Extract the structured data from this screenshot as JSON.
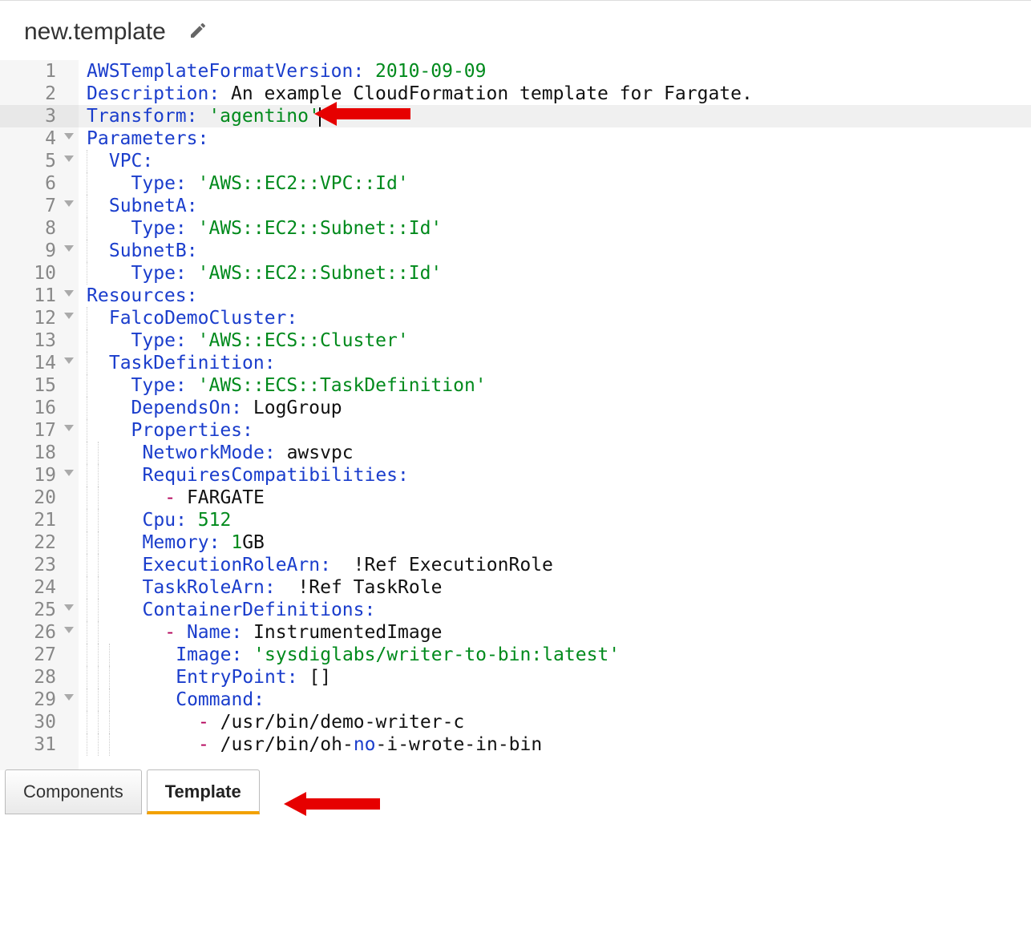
{
  "header": {
    "title": "new.template"
  },
  "tabs": {
    "components": "Components",
    "template": "Template"
  },
  "code": {
    "lines": [
      {
        "num": "1",
        "fold": false,
        "active": false,
        "tokens": [
          {
            "c": "key",
            "t": "AWSTemplateFormatVersion: "
          },
          {
            "c": "str",
            "t": "2010-09-09"
          }
        ]
      },
      {
        "num": "2",
        "fold": false,
        "active": false,
        "tokens": [
          {
            "c": "key",
            "t": "Description: "
          },
          {
            "c": "txt",
            "t": "An example CloudFormation template for Fargate."
          }
        ]
      },
      {
        "num": "3",
        "fold": false,
        "active": true,
        "tokens": [
          {
            "c": "key",
            "t": "Transform: "
          },
          {
            "c": "str",
            "t": "'agentino'"
          }
        ],
        "cursor": true
      },
      {
        "num": "4",
        "fold": true,
        "active": false,
        "tokens": [
          {
            "c": "key",
            "t": "Parameters:"
          }
        ]
      },
      {
        "num": "5",
        "fold": true,
        "active": false,
        "guides": 1,
        "tokens": [
          {
            "c": "key",
            "t": " VPC:"
          }
        ]
      },
      {
        "num": "6",
        "fold": false,
        "active": false,
        "guides": 1,
        "tokens": [
          {
            "c": "key",
            "t": "   Type: "
          },
          {
            "c": "str",
            "t": "'AWS::EC2::VPC::Id'"
          }
        ]
      },
      {
        "num": "7",
        "fold": true,
        "active": false,
        "guides": 1,
        "tokens": [
          {
            "c": "key",
            "t": " SubnetA:"
          }
        ]
      },
      {
        "num": "8",
        "fold": false,
        "active": false,
        "guides": 1,
        "tokens": [
          {
            "c": "key",
            "t": "   Type: "
          },
          {
            "c": "str",
            "t": "'AWS::EC2::Subnet::Id'"
          }
        ]
      },
      {
        "num": "9",
        "fold": true,
        "active": false,
        "guides": 1,
        "tokens": [
          {
            "c": "key",
            "t": " SubnetB:"
          }
        ]
      },
      {
        "num": "10",
        "fold": false,
        "active": false,
        "guides": 1,
        "tokens": [
          {
            "c": "key",
            "t": "   Type: "
          },
          {
            "c": "str",
            "t": "'AWS::EC2::Subnet::Id'"
          }
        ]
      },
      {
        "num": "11",
        "fold": true,
        "active": false,
        "tokens": [
          {
            "c": "key",
            "t": "Resources:"
          }
        ]
      },
      {
        "num": "12",
        "fold": true,
        "active": false,
        "guides": 1,
        "tokens": [
          {
            "c": "key",
            "t": " FalcoDemoCluster:"
          }
        ]
      },
      {
        "num": "13",
        "fold": false,
        "active": false,
        "guides": 1,
        "tokens": [
          {
            "c": "key",
            "t": "   Type: "
          },
          {
            "c": "str",
            "t": "'AWS::ECS::Cluster'"
          }
        ]
      },
      {
        "num": "14",
        "fold": true,
        "active": false,
        "guides": 1,
        "tokens": [
          {
            "c": "key",
            "t": " TaskDefinition:"
          }
        ]
      },
      {
        "num": "15",
        "fold": false,
        "active": false,
        "guides": 1,
        "tokens": [
          {
            "c": "key",
            "t": "   Type: "
          },
          {
            "c": "str",
            "t": "'AWS::ECS::TaskDefinition'"
          }
        ]
      },
      {
        "num": "16",
        "fold": false,
        "active": false,
        "guides": 1,
        "tokens": [
          {
            "c": "key",
            "t": "   DependsOn: "
          },
          {
            "c": "txt",
            "t": "LogGroup"
          }
        ]
      },
      {
        "num": "17",
        "fold": true,
        "active": false,
        "guides": 1,
        "tokens": [
          {
            "c": "key",
            "t": "   Properties:"
          }
        ]
      },
      {
        "num": "18",
        "fold": false,
        "active": false,
        "guides": 2,
        "tokens": [
          {
            "c": "key",
            "t": "   NetworkMode: "
          },
          {
            "c": "txt",
            "t": "awsvpc"
          }
        ]
      },
      {
        "num": "19",
        "fold": true,
        "active": false,
        "guides": 2,
        "tokens": [
          {
            "c": "key",
            "t": "   RequiresCompatibilities:"
          }
        ]
      },
      {
        "num": "20",
        "fold": false,
        "active": false,
        "guides": 2,
        "tokens": [
          {
            "c": "txt",
            "t": "     "
          },
          {
            "c": "dash",
            "t": "-"
          },
          {
            "c": "txt",
            "t": " FARGATE"
          }
        ]
      },
      {
        "num": "21",
        "fold": false,
        "active": false,
        "guides": 2,
        "tokens": [
          {
            "c": "key",
            "t": "   Cpu: "
          },
          {
            "c": "str",
            "t": "512"
          }
        ]
      },
      {
        "num": "22",
        "fold": false,
        "active": false,
        "guides": 2,
        "tokens": [
          {
            "c": "key",
            "t": "   Memory: "
          },
          {
            "c": "str",
            "t": "1"
          },
          {
            "c": "txt",
            "t": "GB"
          }
        ]
      },
      {
        "num": "23",
        "fold": false,
        "active": false,
        "guides": 2,
        "tokens": [
          {
            "c": "key",
            "t": "   ExecutionRoleArn: "
          },
          {
            "c": "txt",
            "t": " !Ref ExecutionRole"
          }
        ]
      },
      {
        "num": "24",
        "fold": false,
        "active": false,
        "guides": 2,
        "tokens": [
          {
            "c": "key",
            "t": "   TaskRoleArn: "
          },
          {
            "c": "txt",
            "t": " !Ref TaskRole"
          }
        ]
      },
      {
        "num": "25",
        "fold": true,
        "active": false,
        "guides": 2,
        "tokens": [
          {
            "c": "key",
            "t": "   ContainerDefinitions:"
          }
        ]
      },
      {
        "num": "26",
        "fold": true,
        "active": false,
        "guides": 2,
        "tokens": [
          {
            "c": "txt",
            "t": "     "
          },
          {
            "c": "dash",
            "t": "-"
          },
          {
            "c": "key",
            "t": " Name: "
          },
          {
            "c": "txt",
            "t": "InstrumentedImage"
          }
        ]
      },
      {
        "num": "27",
        "fold": false,
        "active": false,
        "guides": 3,
        "tokens": [
          {
            "c": "key",
            "t": "     Image: "
          },
          {
            "c": "str",
            "t": "'sysdiglabs/writer-to-bin:latest'"
          }
        ]
      },
      {
        "num": "28",
        "fold": false,
        "active": false,
        "guides": 3,
        "tokens": [
          {
            "c": "key",
            "t": "     EntryPoint: "
          },
          {
            "c": "txt",
            "t": "[]"
          }
        ]
      },
      {
        "num": "29",
        "fold": true,
        "active": false,
        "guides": 3,
        "tokens": [
          {
            "c": "key",
            "t": "     Command:"
          }
        ]
      },
      {
        "num": "30",
        "fold": false,
        "active": false,
        "guides": 3,
        "tokens": [
          {
            "c": "txt",
            "t": "       "
          },
          {
            "c": "dash",
            "t": "-"
          },
          {
            "c": "txt",
            "t": " /usr/bin/demo-writer-c"
          }
        ]
      },
      {
        "num": "31",
        "fold": false,
        "active": false,
        "guides": 3,
        "tokens": [
          {
            "c": "txt",
            "t": "       "
          },
          {
            "c": "dash",
            "t": "-"
          },
          {
            "c": "txt",
            "t": " /usr/bin/oh-"
          },
          {
            "c": "key",
            "t": "no"
          },
          {
            "c": "txt",
            "t": "-i-wrote-in-bin"
          }
        ]
      }
    ]
  }
}
